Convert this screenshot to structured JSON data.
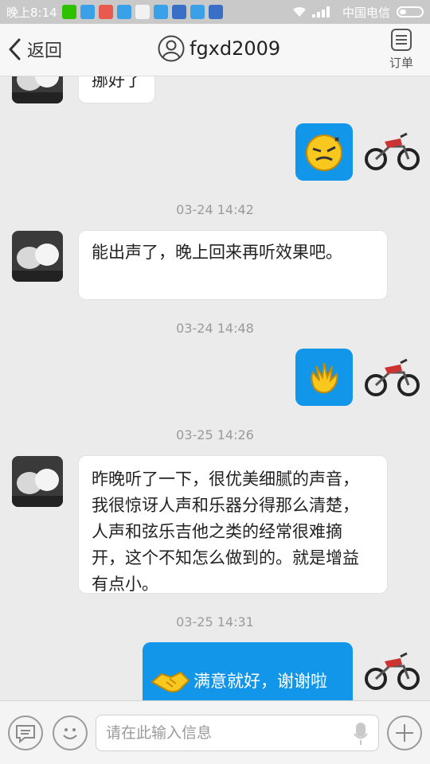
{
  "status_bar": {
    "time": "晚上8:14",
    "carrier": "中国电信"
  },
  "header": {
    "back_label": "返回",
    "contact_name": "fgxd2009",
    "order_label": "订单"
  },
  "messages": [
    {
      "from": "them",
      "text": "挪好了"
    },
    {
      "from": "me",
      "emoji": "grimace-emoticon"
    },
    {
      "timestamp": "03-24 14:42"
    },
    {
      "from": "them",
      "text": "能出声了，晚上回来再听效果吧。"
    },
    {
      "timestamp": "03-24 14:48"
    },
    {
      "from": "me",
      "emoji": "wave-hand-emoticon"
    },
    {
      "timestamp": "03-25 14:26"
    },
    {
      "from": "them",
      "text": "昨晚听了一下，很优美细腻的声音，我很惊讶人声和乐器分得那么清楚，人声和弦乐吉他之类的经常很难摘开，这个不知怎么做到的。就是增益有点小。"
    },
    {
      "timestamp": "03-25 14:31"
    },
    {
      "from": "me",
      "emoji": "handshake-emoticon",
      "text": "满意就好，谢谢啦"
    }
  ],
  "input_bar": {
    "placeholder": "请在此输入信息"
  },
  "colors": {
    "accent": "#1296ea",
    "status_bar_bg": "#c9c9c9",
    "chat_bg": "#ebebeb"
  }
}
